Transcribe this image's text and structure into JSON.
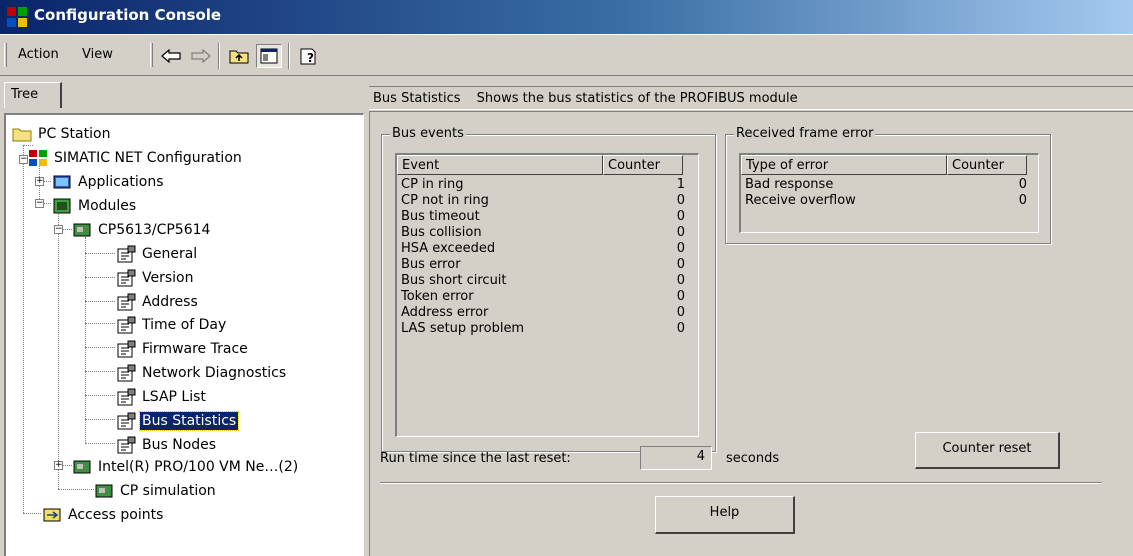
{
  "window": {
    "title": "Configuration Console",
    "app_icon": "simatic-net-icon"
  },
  "menu": {
    "action_label": "Action",
    "view_label": "View"
  },
  "toolbar": {
    "icons": [
      "back-arrow-icon",
      "forward-arrow-icon",
      "up-one-level-icon",
      "show-hide-tree-icon",
      "help-icon"
    ]
  },
  "tree_tab": {
    "label": "Tree"
  },
  "tree": [
    {
      "label": "PC Station",
      "icon": "folder-icon"
    },
    {
      "label": "SIMATIC NET Configuration",
      "icon": "simatic-net-icon"
    },
    {
      "label": "Applications",
      "icon": "applications-icon"
    },
    {
      "label": "Modules",
      "icon": "modules-icon"
    },
    {
      "label": "CP5613/CP5614",
      "icon": "module-card-icon"
    },
    {
      "label": "General",
      "icon": "property-page-icon"
    },
    {
      "label": "Version",
      "icon": "property-page-icon"
    },
    {
      "label": "Address",
      "icon": "property-page-icon"
    },
    {
      "label": "Time of Day",
      "icon": "property-page-icon"
    },
    {
      "label": "Firmware Trace",
      "icon": "property-page-icon"
    },
    {
      "label": "Network Diagnostics",
      "icon": "property-page-icon"
    },
    {
      "label": "LSAP List",
      "icon": "property-page-icon"
    },
    {
      "label": "Bus Statistics",
      "icon": "property-page-icon",
      "selected": true
    },
    {
      "label": "Bus Nodes",
      "icon": "property-page-icon"
    },
    {
      "label": "Intel(R) PRO/100 VM Ne…(2)",
      "icon": "module-card-icon"
    },
    {
      "label": "CP simulation",
      "icon": "module-card-icon"
    },
    {
      "label": "Access points",
      "icon": "access-points-icon"
    }
  ],
  "header": {
    "title": "Bus Statistics",
    "description": "Shows the bus statistics of the PROFIBUS module"
  },
  "bus_events": {
    "legend": "Bus events",
    "columns": [
      "Event",
      "Counter"
    ],
    "rows": [
      {
        "event": "CP in ring",
        "counter": "1"
      },
      {
        "event": "CP not in ring",
        "counter": "0"
      },
      {
        "event": "Bus timeout",
        "counter": "0"
      },
      {
        "event": "Bus collision",
        "counter": "0"
      },
      {
        "event": "HSA exceeded",
        "counter": "0"
      },
      {
        "event": "Bus error",
        "counter": "0"
      },
      {
        "event": "Bus short circuit",
        "counter": "0"
      },
      {
        "event": "Token error",
        "counter": "0"
      },
      {
        "event": "Address error",
        "counter": "0"
      },
      {
        "event": "LAS setup problem",
        "counter": "0"
      }
    ]
  },
  "frame_errors": {
    "legend": "Received frame error",
    "columns": [
      "Type of error",
      "Counter"
    ],
    "rows": [
      {
        "type": "Bad response",
        "counter": "0"
      },
      {
        "type": "Receive overflow",
        "counter": "0"
      }
    ]
  },
  "runtime": {
    "label": "Run time since the last reset:",
    "value": "4",
    "unit": "seconds"
  },
  "buttons": {
    "counter_reset": "Counter reset",
    "help": "Help"
  }
}
